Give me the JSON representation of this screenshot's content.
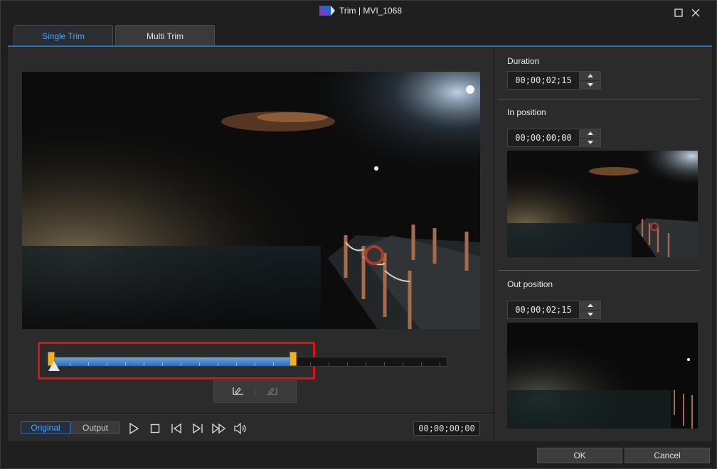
{
  "window": {
    "title": "Trim | MVI_1068"
  },
  "tabs": [
    {
      "label": "Single Trim"
    },
    {
      "label": "Multi Trim"
    }
  ],
  "preview": {
    "in_fraction": 0.0,
    "out_fraction": 0.61,
    "playhead_fraction": 0.0
  },
  "view_toggle": {
    "original": "Original",
    "output": "Output"
  },
  "timecode": "00;00;00;00",
  "right": {
    "duration": {
      "label": "Duration",
      "value": "00;00;02;15"
    },
    "in_position": {
      "label": "In position",
      "value": "00;00;00;00"
    },
    "out_position": {
      "label": "Out position",
      "value": "00;00;02;15"
    }
  },
  "buttons": {
    "ok": "OK",
    "cancel": "Cancel"
  },
  "colors": {
    "accent": "#2f6bb3",
    "highlight": "#e01010",
    "handle": "#f2b21b"
  }
}
